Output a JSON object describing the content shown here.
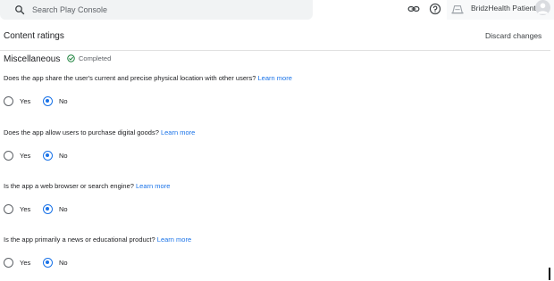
{
  "search": {
    "placeholder": "Search Play Console"
  },
  "header": {
    "app_name": "BridzHealth Patient"
  },
  "page": {
    "title": "Content ratings",
    "discard_label": "Discard changes"
  },
  "section": {
    "title": "Miscellaneous",
    "status": "Completed"
  },
  "questions": [
    {
      "text": "Does the app share the user's current and precise physical location with other users?",
      "learn_more": "Learn more",
      "yes_label": "Yes",
      "no_label": "No",
      "selected": "No"
    },
    {
      "text": "Does the app allow users to purchase digital goods?",
      "learn_more": "Learn more",
      "yes_label": "Yes",
      "no_label": "No",
      "selected": "No"
    },
    {
      "text": "Is the app a web browser or search engine?",
      "learn_more": "Learn more",
      "yes_label": "Yes",
      "no_label": "No",
      "selected": "No"
    },
    {
      "text": "Is the app primarily a news or educational product?",
      "learn_more": "Learn more",
      "yes_label": "Yes",
      "no_label": "No",
      "selected": "No"
    }
  ],
  "colors": {
    "accent": "#1a73e8",
    "success": "#188038",
    "text": "#202124",
    "muted": "#5f6368",
    "search_bg": "#f1f3f4"
  },
  "icons": {
    "search": "search-icon",
    "link": "link-icon",
    "help": "help-icon",
    "app": "app-icon",
    "avatar": "avatar-icon",
    "status": "check-circle-icon"
  }
}
